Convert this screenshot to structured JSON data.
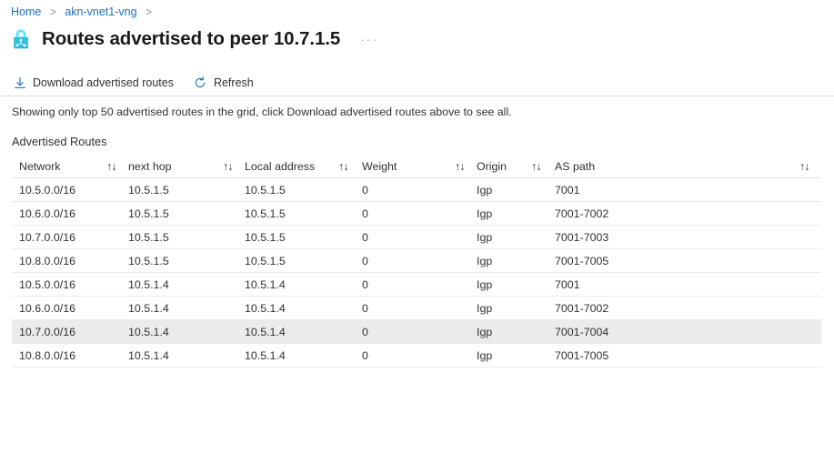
{
  "breadcrumb": {
    "items": [
      {
        "label": "Home",
        "link": true
      },
      {
        "label": "akn-vnet1-vng",
        "link": true
      }
    ],
    "separator": ">"
  },
  "header": {
    "icon": "vpn-gateway-lock-icon",
    "title": "Routes advertised to peer 10.7.1.5",
    "more_menu": "···"
  },
  "toolbar": {
    "download_label": "Download advertised routes",
    "download_icon": "download-icon",
    "refresh_label": "Refresh",
    "refresh_icon": "refresh-icon"
  },
  "info": {
    "message": "Showing only top 50 advertised routes in the grid, click Download advertised routes above to see all."
  },
  "grid": {
    "section_label": "Advertised Routes",
    "sort_glyph": "↑↓",
    "columns": [
      {
        "key": "network",
        "label": "Network"
      },
      {
        "key": "next_hop",
        "label": "next hop"
      },
      {
        "key": "local_address",
        "label": "Local address"
      },
      {
        "key": "weight",
        "label": "Weight"
      },
      {
        "key": "origin",
        "label": "Origin"
      },
      {
        "key": "as_path",
        "label": "AS path"
      }
    ],
    "rows": [
      {
        "network": "10.5.0.0/16",
        "next_hop": "10.5.1.5",
        "local_address": "10.5.1.5",
        "weight": "0",
        "origin": "Igp",
        "as_path": "7001",
        "highlight": false
      },
      {
        "network": "10.6.0.0/16",
        "next_hop": "10.5.1.5",
        "local_address": "10.5.1.5",
        "weight": "0",
        "origin": "Igp",
        "as_path": "7001-7002",
        "highlight": false
      },
      {
        "network": "10.7.0.0/16",
        "next_hop": "10.5.1.5",
        "local_address": "10.5.1.5",
        "weight": "0",
        "origin": "Igp",
        "as_path": "7001-7003",
        "highlight": false
      },
      {
        "network": "10.8.0.0/16",
        "next_hop": "10.5.1.5",
        "local_address": "10.5.1.5",
        "weight": "0",
        "origin": "Igp",
        "as_path": "7001-7005",
        "highlight": false
      },
      {
        "network": "10.5.0.0/16",
        "next_hop": "10.5.1.4",
        "local_address": "10.5.1.4",
        "weight": "0",
        "origin": "Igp",
        "as_path": "7001",
        "highlight": false
      },
      {
        "network": "10.6.0.0/16",
        "next_hop": "10.5.1.4",
        "local_address": "10.5.1.4",
        "weight": "0",
        "origin": "Igp",
        "as_path": "7001-7002",
        "highlight": false
      },
      {
        "network": "10.7.0.0/16",
        "next_hop": "10.5.1.4",
        "local_address": "10.5.1.4",
        "weight": "0",
        "origin": "Igp",
        "as_path": "7001-7004",
        "highlight": true
      },
      {
        "network": "10.8.0.0/16",
        "next_hop": "10.5.1.4",
        "local_address": "10.5.1.4",
        "weight": "0",
        "origin": "Igp",
        "as_path": "7001-7005",
        "highlight": false
      }
    ]
  },
  "colors": {
    "accent": "#0078d4",
    "link": "#2272b9",
    "text": "#323130",
    "title": "#1b1a19",
    "row_highlight": "#ebebeb",
    "border": "#edebe9",
    "icon_cyan": "#32bedd"
  }
}
